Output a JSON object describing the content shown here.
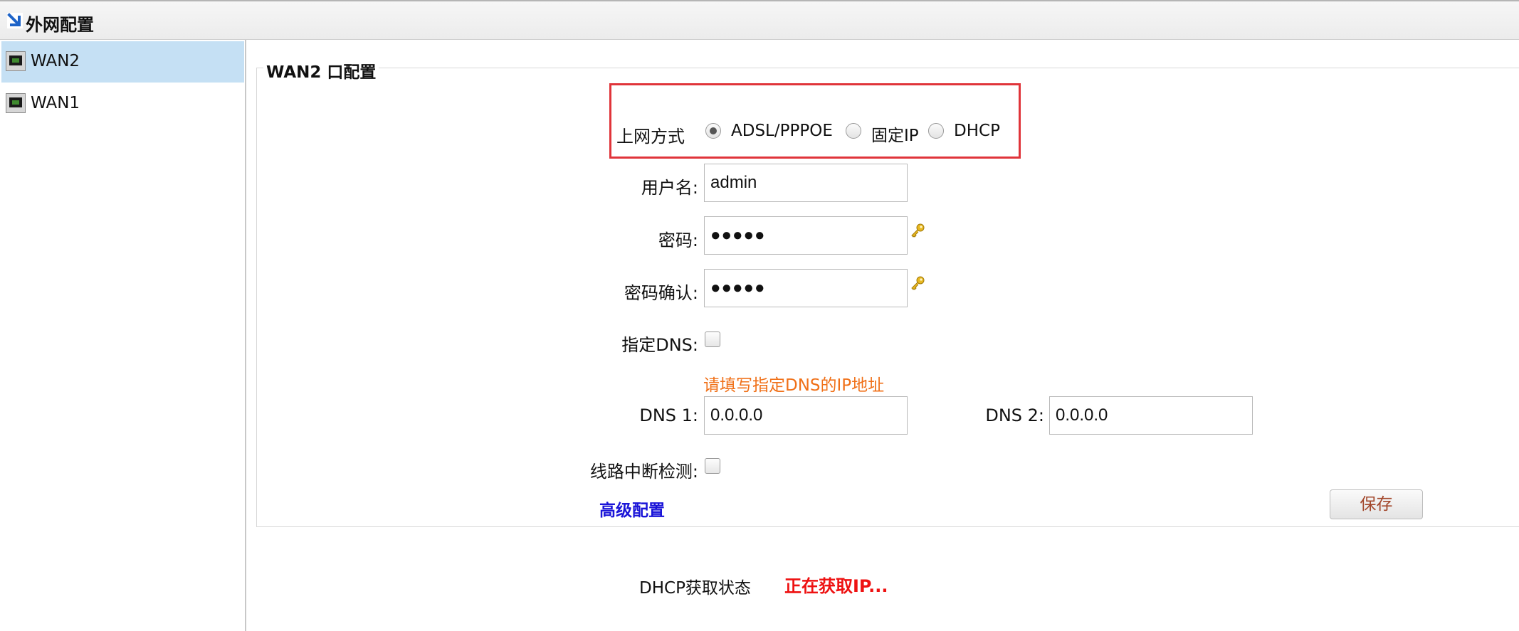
{
  "window": {
    "title": "外网配置"
  },
  "sidebar": {
    "items": [
      {
        "label": "WAN2",
        "selected": true
      },
      {
        "label": "WAN1",
        "selected": false
      }
    ]
  },
  "panel": {
    "legend": "WAN2 口配置"
  },
  "connection": {
    "label": "上网方式",
    "options": [
      {
        "label": "ADSL/PPPOE",
        "checked": true
      },
      {
        "label": "固定IP",
        "checked": false
      },
      {
        "label": "DHCP",
        "checked": false
      }
    ]
  },
  "form": {
    "username_label": "用户名:",
    "username_value": "admin",
    "password_label": "密码:",
    "password_value": "●●●●●",
    "confirm_label": "密码确认:",
    "confirm_value": "●●●●●",
    "dns_label": "指定DNS:",
    "dns_checked": false,
    "dns_hint": "请填写指定DNS的IP地址",
    "dns1_label": "DNS 1:",
    "dns1_value": "0.0.0.0",
    "dns2_label": "DNS 2:",
    "dns2_value": "0.0.0.0",
    "line_check_label": "线路中断检测:",
    "line_check_checked": false
  },
  "advanced_link": "高级配置",
  "save_button": "保存",
  "status": {
    "label": "DHCP获取状态",
    "value": "正在获取IP..."
  },
  "colors": {
    "highlight_border": "#e0343a",
    "hint": "#f07018",
    "link": "#1a14d8",
    "status_value": "#ee1111",
    "selected_row": "#c5e0f4"
  }
}
